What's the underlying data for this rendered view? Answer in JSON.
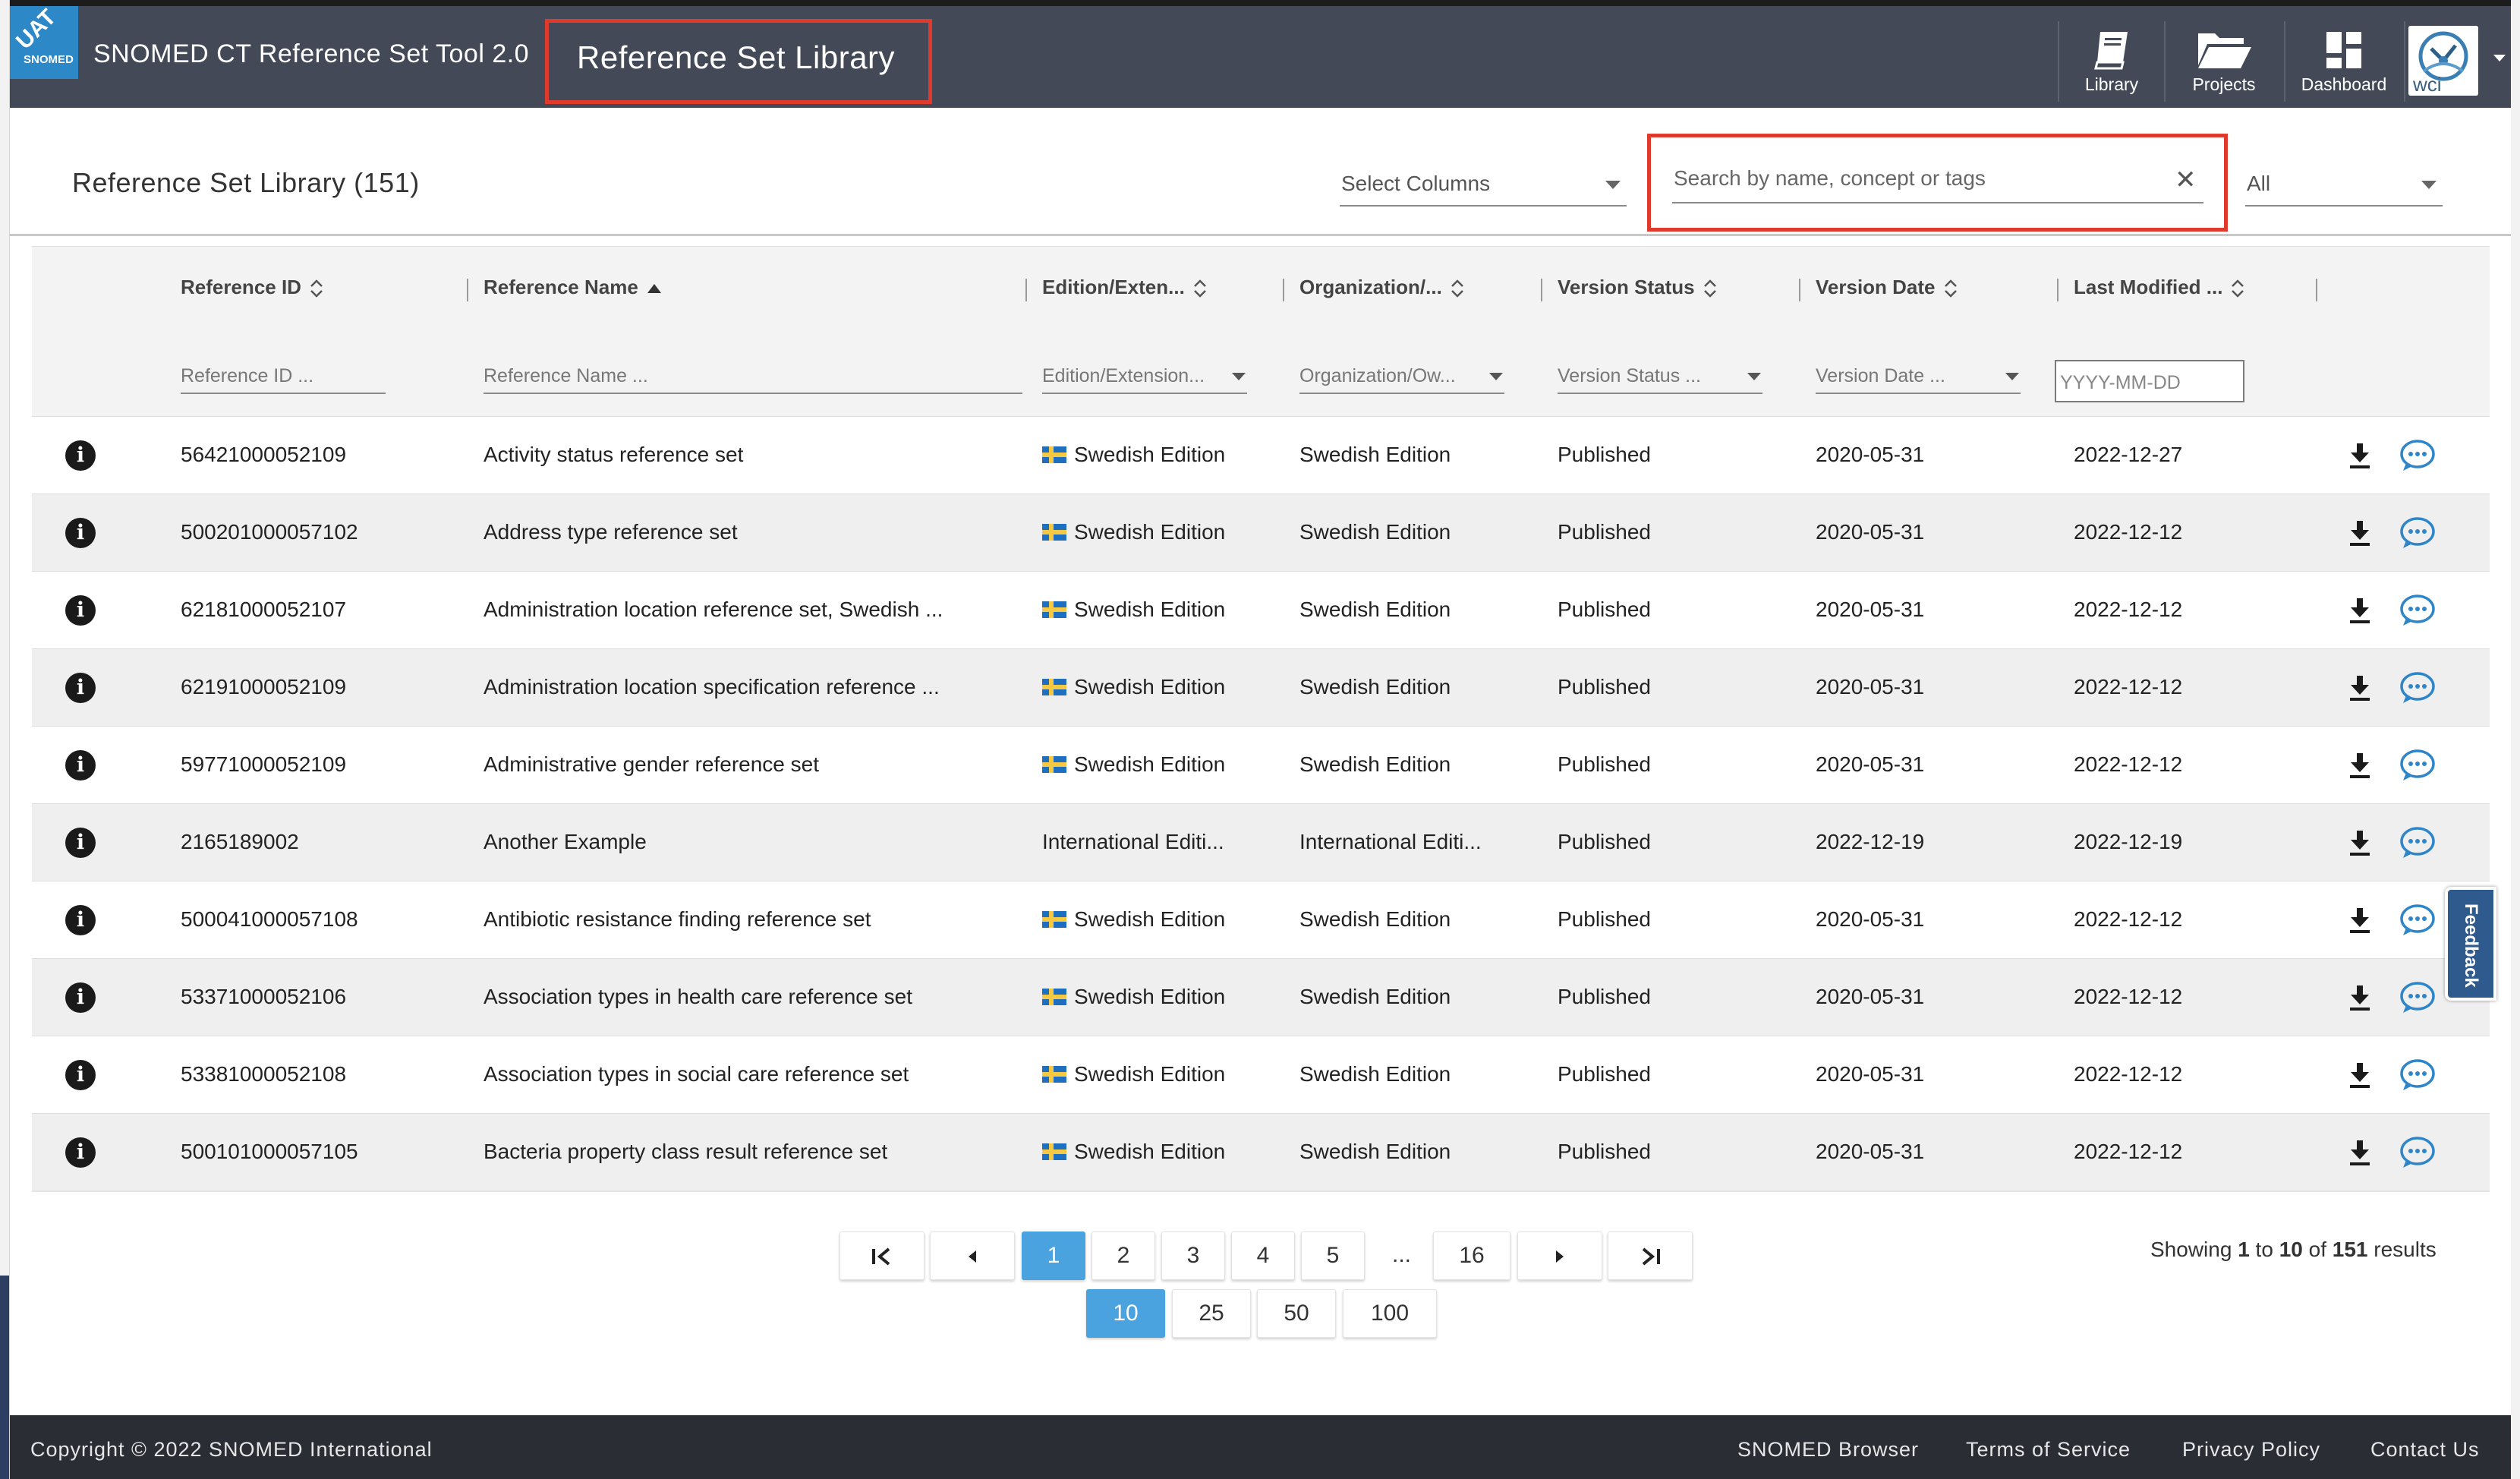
{
  "header": {
    "badge": "UAT",
    "logo_text": "SNOMED",
    "app_title": "SNOMED CT Reference Set Tool 2.0",
    "breadcrumb": "Reference Set Library",
    "nav": [
      {
        "label": "Library",
        "icon": "book-icon"
      },
      {
        "label": "Projects",
        "icon": "folder-open-icon"
      },
      {
        "label": "Dashboard",
        "icon": "dashboard-grid-icon"
      }
    ],
    "avatar_text": "wci"
  },
  "toolbar": {
    "heading": "Reference Set Library (151)",
    "select_columns_label": "Select Columns",
    "search_placeholder": "Search by name, concept or tags",
    "search_value": "",
    "status_filter": "All"
  },
  "table": {
    "columns": [
      "Reference ID",
      "Reference Name",
      "Edition/Exten...",
      "Organization/...",
      "Version Status",
      "Version Date",
      "Last Modified ..."
    ],
    "sorted_column": "Reference Name",
    "filters": [
      "Reference ID ...",
      "Reference Name ...",
      "Edition/Extension...",
      "Organization/Ow...",
      "Version Status ...",
      "Version Date ...",
      "YYYY-MM-DD"
    ],
    "rows": [
      {
        "id": "56421000052109",
        "name": "Activity status reference set",
        "edition": "Swedish Edition",
        "org": "Swedish Edition",
        "status": "Published",
        "version_date": "2020-05-31",
        "modified": "2022-12-27",
        "flag": true
      },
      {
        "id": "500201000057102",
        "name": "Address type reference set",
        "edition": "Swedish Edition",
        "org": "Swedish Edition",
        "status": "Published",
        "version_date": "2020-05-31",
        "modified": "2022-12-12",
        "flag": true
      },
      {
        "id": "62181000052107",
        "name": "Administration location reference set, Swedish ...",
        "edition": "Swedish Edition",
        "org": "Swedish Edition",
        "status": "Published",
        "version_date": "2020-05-31",
        "modified": "2022-12-12",
        "flag": true
      },
      {
        "id": "62191000052109",
        "name": "Administration location specification reference ...",
        "edition": "Swedish Edition",
        "org": "Swedish Edition",
        "status": "Published",
        "version_date": "2020-05-31",
        "modified": "2022-12-12",
        "flag": true
      },
      {
        "id": "59771000052109",
        "name": "Administrative gender reference set",
        "edition": "Swedish Edition",
        "org": "Swedish Edition",
        "status": "Published",
        "version_date": "2020-05-31",
        "modified": "2022-12-12",
        "flag": true
      },
      {
        "id": "2165189002",
        "name": "Another Example",
        "edition": "International Editi...",
        "org": "International Editi...",
        "status": "Published",
        "version_date": "2022-12-19",
        "modified": "2022-12-19",
        "flag": false
      },
      {
        "id": "500041000057108",
        "name": "Antibiotic resistance finding reference set",
        "edition": "Swedish Edition",
        "org": "Swedish Edition",
        "status": "Published",
        "version_date": "2020-05-31",
        "modified": "2022-12-12",
        "flag": true
      },
      {
        "id": "53371000052106",
        "name": "Association types in health care reference set",
        "edition": "Swedish Edition",
        "org": "Swedish Edition",
        "status": "Published",
        "version_date": "2020-05-31",
        "modified": "2022-12-12",
        "flag": true
      },
      {
        "id": "53381000052108",
        "name": "Association types in social care reference set",
        "edition": "Swedish Edition",
        "org": "Swedish Edition",
        "status": "Published",
        "version_date": "2020-05-31",
        "modified": "2022-12-12",
        "flag": true
      },
      {
        "id": "500101000057105",
        "name": "Bacteria property class result reference set",
        "edition": "Swedish Edition",
        "org": "Swedish Edition",
        "status": "Published",
        "version_date": "2020-05-31",
        "modified": "2022-12-12",
        "flag": true
      }
    ]
  },
  "pagination": {
    "pages": [
      "1",
      "2",
      "3",
      "4",
      "5"
    ],
    "ellipsis": "...",
    "last_page": "16",
    "current_page": "1",
    "page_sizes": [
      "10",
      "25",
      "50",
      "100"
    ],
    "current_page_size": "10",
    "showing": {
      "prefix": "Showing",
      "from": "1",
      "to_word": "to",
      "to": "10",
      "of_word": "of",
      "total": "151",
      "suffix": "results"
    }
  },
  "feedback_label": "Feedback",
  "footer": {
    "copyright": "Copyright © 2022 SNOMED International",
    "links": [
      "SNOMED Browser",
      "Terms of Service",
      "Privacy Policy",
      "Contact Us"
    ]
  },
  "colors": {
    "header_bg": "#434956",
    "accent_blue": "#4aa3df",
    "highlight_red": "#e03a2c",
    "footer_bg": "#2a2d34",
    "chat_icon": "#2e86c9"
  }
}
